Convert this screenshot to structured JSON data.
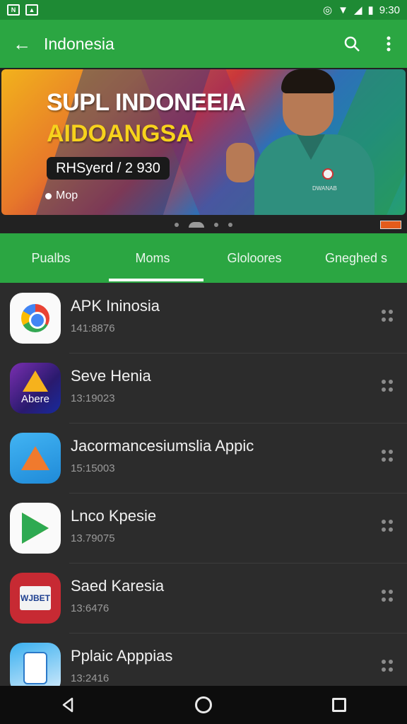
{
  "status_bar": {
    "left_icons": [
      "notification-icon",
      "image-icon"
    ],
    "right_icons": [
      "sync-icon",
      "wifi-icon",
      "signal-icon",
      "battery-icon"
    ],
    "time": "9:30"
  },
  "app_bar": {
    "title": "Indonesia",
    "back_icon": "arrow-left-icon",
    "search_icon": "search-icon",
    "menu_icon": "more-vertical-icon"
  },
  "banner": {
    "headline": "SUPL INDONEEIA",
    "subheadline": "AIDOANGSA",
    "pill_text": "RHSyerd / 2 930",
    "link_text": "Mop",
    "shirt_brand": "DWANAB",
    "pager_count": 4,
    "pager_active": 1
  },
  "tabs": [
    {
      "label": "Pualbs",
      "active": false
    },
    {
      "label": "Moms",
      "active": true
    },
    {
      "label": "Gloloores",
      "active": false
    },
    {
      "label": "Gneghed s",
      "active": false
    }
  ],
  "apps": [
    {
      "name": "APK Ininosia",
      "meta": "141:8876",
      "icon": "chrome-icon"
    },
    {
      "name": "Seve Henia",
      "meta": "13:19023",
      "icon": "abere-icon",
      "icon_label": "Abere"
    },
    {
      "name": "Jacormancesiumslia Appic",
      "meta": "15:15003",
      "icon": "arrow-blue-icon"
    },
    {
      "name": "Lnco Kpesie",
      "meta": "13.79075",
      "icon": "play-icon"
    },
    {
      "name": "Saed Karesia",
      "meta": "13:6476",
      "icon": "card-icon",
      "icon_label": "WJBET"
    },
    {
      "name": "Pplaic Apppias",
      "meta": "13:2416",
      "icon": "phone-apps-icon"
    }
  ],
  "nav": {
    "back": "nav-back-icon",
    "home": "nav-home-icon",
    "recents": "nav-recents-icon"
  }
}
